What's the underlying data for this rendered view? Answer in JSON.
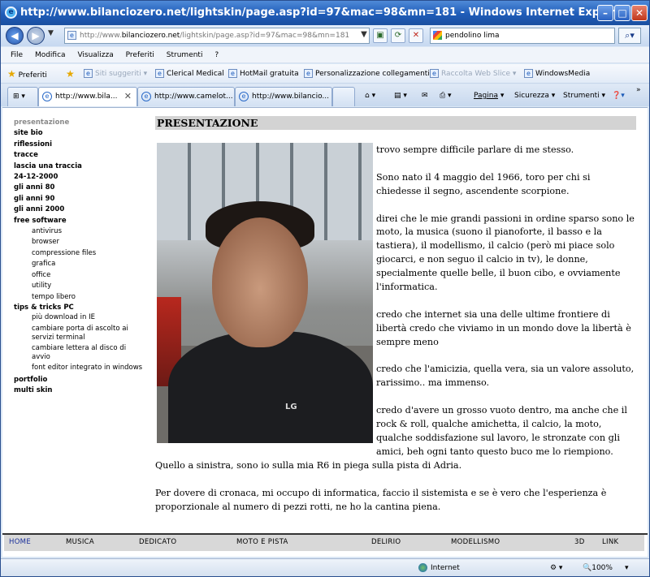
{
  "window": {
    "title": "http://www.bilanciozero.net/lightskin/page.asp?id=97&mac=98&mn=181 - Windows Internet Explorer",
    "min": "–",
    "max": "□",
    "close": "✕"
  },
  "address": {
    "prefix": "http://www.",
    "domain": "bilanciozero.net",
    "path": "/lightskin/page.asp?id=97&mac=98&mn=181",
    "search_value": "pendolino lima"
  },
  "menu": [
    "File",
    "Modifica",
    "Visualizza",
    "Preferiti",
    "Strumenti",
    "?"
  ],
  "favorites": {
    "label": "Preferiti",
    "items": [
      "Siti suggeriti",
      "Clerical Medical",
      "HotMail gratuita",
      "Personalizzazione collegamenti",
      "Raccolta Web Slice",
      "WindowsMedia"
    ]
  },
  "tabs": [
    "http://www.bila...",
    "http://www.camelot...",
    "http://www.bilancio..."
  ],
  "commands": {
    "page": "Pagina",
    "security": "Sicurezza",
    "tools": "Strumenti"
  },
  "sidebar": {
    "current": "presentazione",
    "items": [
      "site bio",
      "riflessioni",
      "tracce",
      "lascia una traccia",
      "24-12-2000",
      "gli anni 80",
      "gli anni 90",
      "gli anni 2000",
      "free software"
    ],
    "free_software": [
      "antivirus",
      "browser",
      "compressione files",
      "grafica",
      "office",
      "utility",
      "tempo libero"
    ],
    "tips_label": "tips & tricks PC",
    "tips": [
      "più download in IE",
      "cambiare porta di ascolto ai servizi terminal",
      "cambiare lettera al disco di avvio",
      "font editor integrato in windows"
    ],
    "after": [
      "portfolio",
      "multi skin"
    ]
  },
  "content": {
    "heading": "PRESENTAZIONE",
    "photo_logo": "LG",
    "paragraphs": [
      "trovo sempre difficile parlare di me stesso.",
      "Sono nato il 4 maggio del 1966, toro per chi si chiedesse il segno, ascendente scorpione.",
      "direi che le mie grandi passioni in ordine sparso sono le moto, la musica (suono il pianoforte, il basso e la tastiera), il modellismo, il calcio (però mi piace solo giocarci, e non seguo il calcio in tv), le donne, specialmente quelle belle, il buon cibo, e ovviamente l'informatica.",
      "credo che internet sia una delle ultime frontiere di libertà credo che viviamo in un mondo dove la libertà è sempre meno",
      "credo che l'amicizia, quella vera, sia un valore assoluto, rarissimo.. ma immenso.",
      "credo d'avere un grosso vuoto dentro, ma anche che il rock & roll, qualche amichetta, il calcio, la moto, qualche soddisfazione sul lavoro, le stronzate con gli amici, beh ogni tanto questo buco me lo riempiono."
    ],
    "bottom": [
      "Quello a sinistra, sono io sulla mia R6 in piega sulla pista di Adria.",
      "Per dovere di cronaca, mi occupo di informatica, faccio il sistemista e se è vero che l'esperienza è proporzionale al numero di pezzi rotti, ne ho la cantina piena."
    ]
  },
  "bottom_nav": [
    "HOME",
    "MUSICA",
    "DEDICATO",
    "MOTO E PISTA",
    "DELIRIO",
    "MODELLISMO",
    "3D",
    "LINK"
  ],
  "status": {
    "zone": "Internet",
    "zoom": "100%"
  }
}
